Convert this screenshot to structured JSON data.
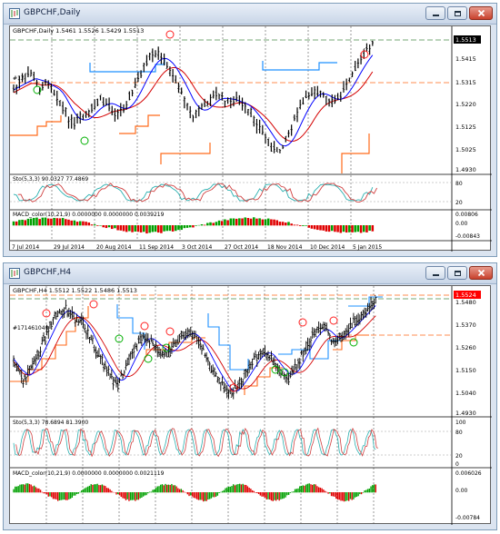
{
  "window1": {
    "title": "GBPCHF,Daily",
    "header": "GBPCHF,Daily   1.5461 1.5526 1.5429 1.5513",
    "price_labels": [
      "1.5610",
      "1.5415",
      "1.5315",
      "1.5220",
      "1.5125",
      "1.5025",
      "1.4930"
    ],
    "current_price": "1.5513",
    "order_label": "#17",
    "sto_label": "Sto(5,3,3) 90.0327 77.4869",
    "sto_ticks": [
      "80",
      "20"
    ],
    "macd_label": "MACD_color(10,21,9) 0.0000000 0.0000000 0.0039219",
    "macd_ticks": [
      "0.00806",
      "0.00",
      "-0.00843"
    ],
    "dates": [
      "7 Jul 2014",
      "29 Jul 2014",
      "20 Aug 2014",
      "11 Sep 2014",
      "3 Oct 2014",
      "27 Oct 2014",
      "18 Nov 2014",
      "10 Dec 2014",
      "5 Jan 2015"
    ]
  },
  "window2": {
    "title": "GBPCHF,H4",
    "header": "GBPCHF,H4   1.5512 1.5522 1.5486 1.5513",
    "price_labels": [
      "1.5480",
      "1.5370",
      "1.5260",
      "1.5150",
      "1.5040",
      "1.4930"
    ],
    "current_price": "1.5524",
    "order_label": "#171461040",
    "sto_label": "Sto(5,3,3) 78.6894 81.3900",
    "sto_ticks": [
      "100",
      "80",
      "20",
      "0"
    ],
    "macd_label": "MACD_color(10,21,9) 0.0000000 0.0000000 0.0021119",
    "macd_ticks": [
      "0.006026",
      "0.00",
      "-0.00784"
    ]
  },
  "colors": {
    "price_line": "#000000",
    "blue_ma": "#0000ff",
    "red_ma": "#d40000",
    "stop_orange": "#ff6a1a",
    "trail_blue": "#1e90ff",
    "green_signal": "#00b000",
    "red_signal": "#ff2020",
    "current_price_bg": "#ff0000"
  },
  "icons": {
    "minimize": "minimize-icon",
    "restore": "restore-icon",
    "close": "close-icon"
  }
}
